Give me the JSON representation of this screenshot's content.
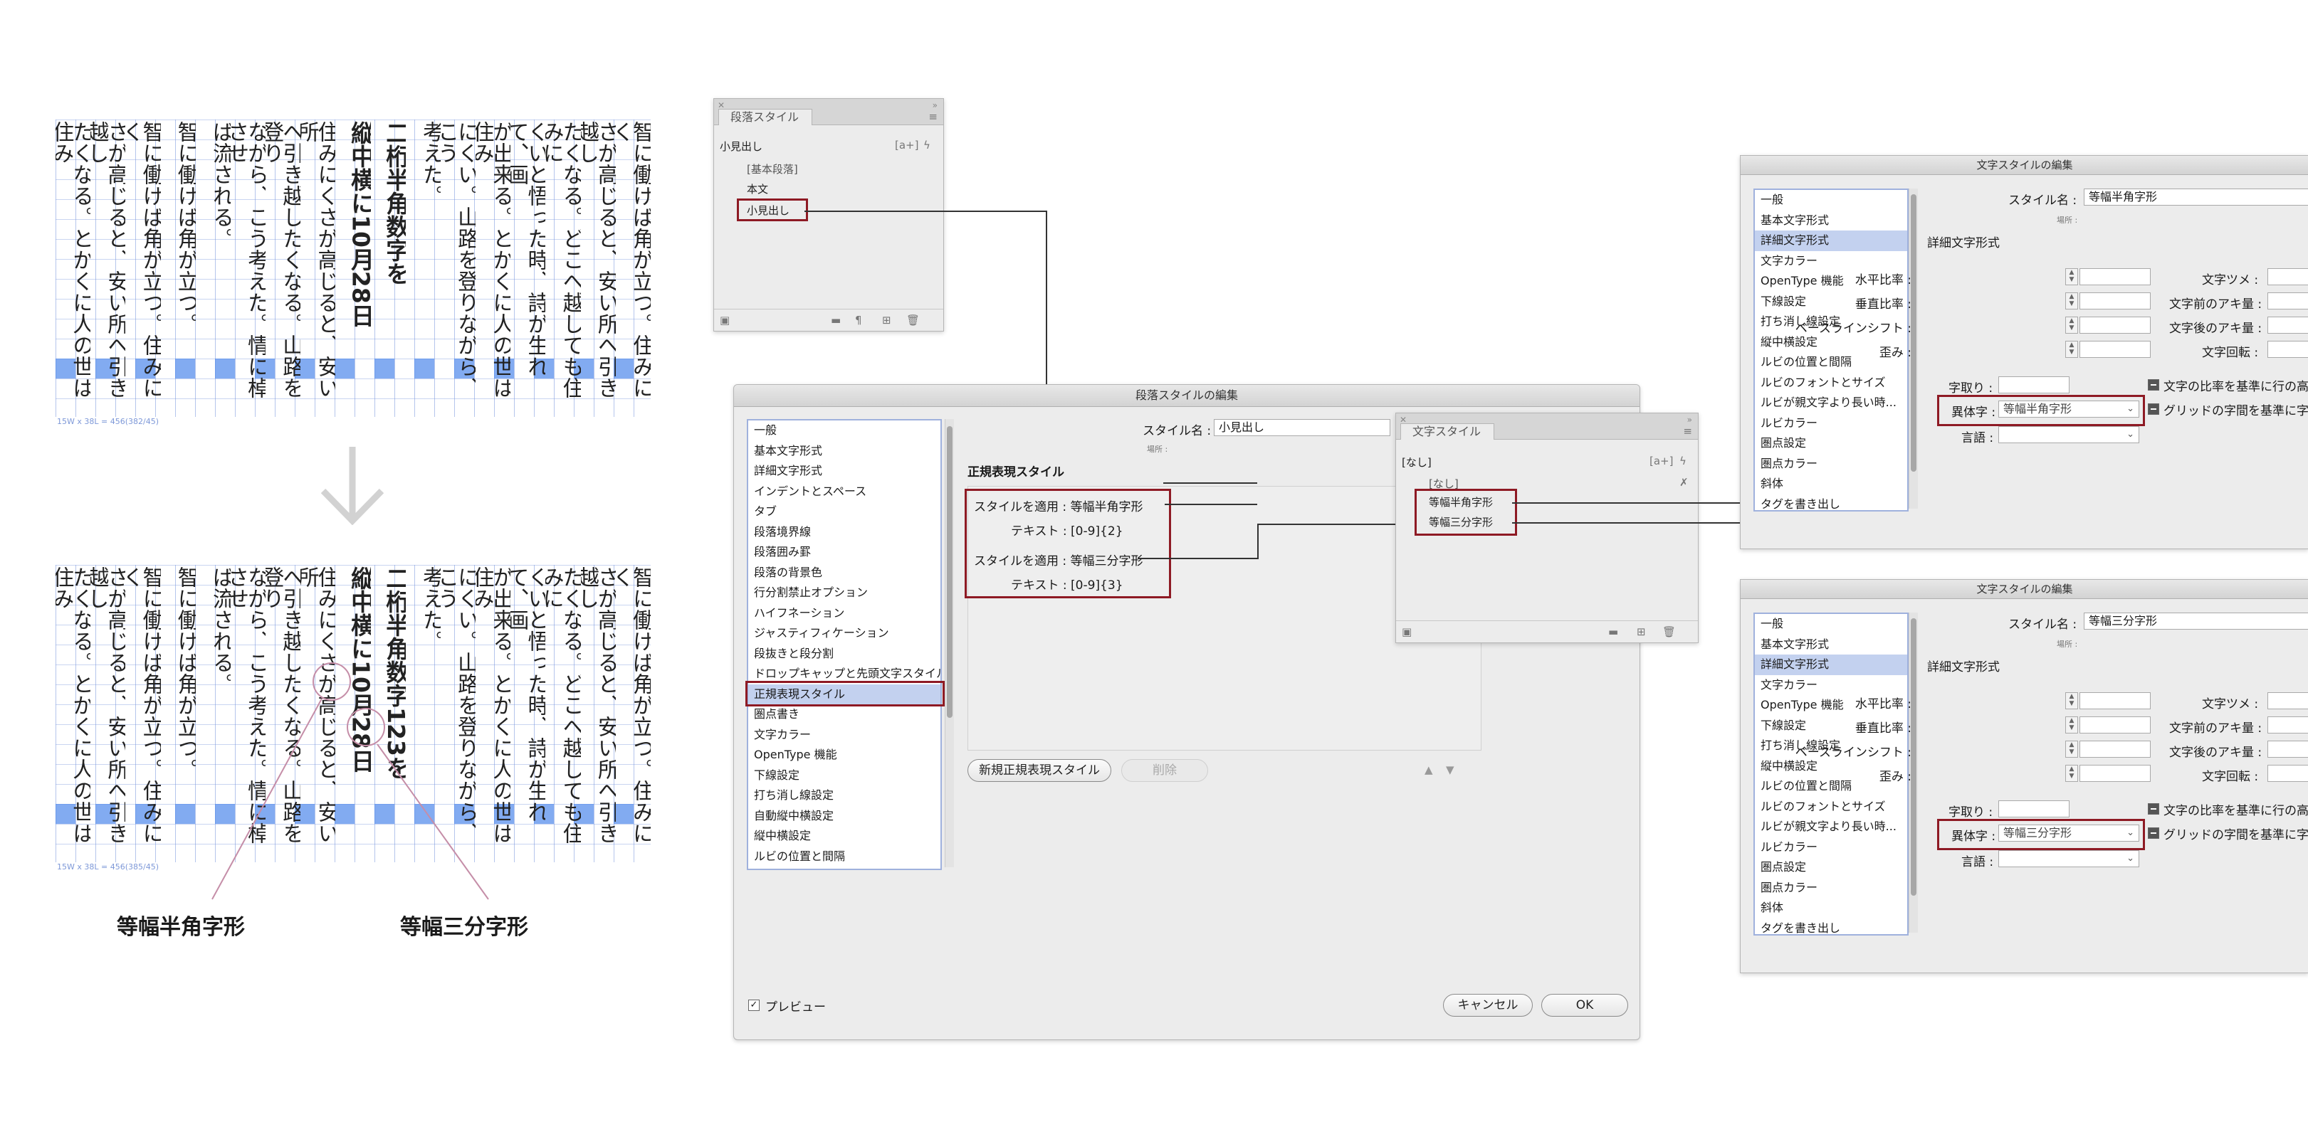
{
  "sample": {
    "before": {
      "columns": [
        "智に働けば角が立つ。住みにく",
        "さが高じると、安い所へ引き越し",
        "たくなる。どこへ越しても住みに",
        "くいと悟った時、詩が生れて、画",
        "が出来る。とかくに人の世は住み",
        "にくい。山路を登りながら、こう",
        "考えた。",
        "二桁半角数字を",
        "縦中横に10月28日",
        "住みにくさが高じると、安い所",
        "へ引き越したくなる。山路を登り",
        "ながら、こう考えた。情に棹させ",
        "ば流される。",
        "智に働けば角が立つ。",
        "智に働けば角が立つ。住みにく",
        "さが高じると、安い所へ引き越し",
        "たくなる。とかくに人の世は住み"
      ],
      "caption": "15W x 38L = 456(382/45)"
    },
    "after": {
      "columns": [
        "智に働けば角が立つ。住みにく",
        "さが高じると、安い所へ引き越し",
        "たくなる。どこへ越しても住みに",
        "くいと悟った時、詩が生れて、画",
        "が出来る。とかくに人の世は住み",
        "にくい。山路を登りながら、こう",
        "考えた。",
        "二桁半角数字123を",
        "縦中横に10月28日",
        "住みにくさが高じると、安い所",
        "へ引き越したくなる。山路を登り",
        "ながら、こう考えた。情に棹させ",
        "ば流される。",
        "智に働けば角が立つ。",
        "智に働けば角が立つ。住みにく",
        "さが高じると、安い所へ引き越し",
        "たくなる。とかくに人の世は住み"
      ],
      "caption": "15W x 38L = 456(385/45)"
    },
    "label_half": "等幅半角字形",
    "label_third": "等幅三分字形"
  },
  "para_panel": {
    "tab": "段落スタイル",
    "current": "小見出し",
    "items": [
      "[基本段落]",
      "本文",
      "小見出し"
    ]
  },
  "para_dialog": {
    "title": "段落スタイルの編集",
    "categories": [
      "一般",
      "基本文字形式",
      "詳細文字形式",
      "インデントとスペース",
      "タブ",
      "段落境界線",
      "段落囲み罫",
      "段落の背景色",
      "行分割禁止オプション",
      "ハイフネーション",
      "ジャスティフィケーション",
      "段抜きと段分割",
      "ドロップキャップと先頭文字スタイル",
      "正規表現スタイル",
      "圏点書き",
      "文字カラー",
      "OpenType 機能",
      "下線設定",
      "打ち消し線設定",
      "自動縦中横設定",
      "縦中横設定",
      "ルビの位置と間隔"
    ],
    "style_name_label": "スタイル名 :",
    "style_name": "小見出し",
    "location_label": "場所 :",
    "section": "正規表現スタイル",
    "rules": [
      {
        "apply": "スタイルを適用 : 等幅半角字形",
        "text": "テキスト : [0-9]{2}"
      },
      {
        "apply": "スタイルを適用 : 等幅三分字形",
        "text": "テキスト : [0-9]{3}"
      }
    ],
    "new_button": "新規正規表現スタイル",
    "delete_button": "削除",
    "preview": "プレビュー",
    "cancel": "キャンセル",
    "ok": "OK"
  },
  "char_panel": {
    "tab": "文字スタイル",
    "current": "[なし]",
    "items": [
      "[なし]",
      "等幅半角字形",
      "等幅三分字形"
    ]
  },
  "char_dialogs": [
    {
      "title": "文字スタイルの編集",
      "categories": [
        "一般",
        "基本文字形式",
        "詳細文字形式",
        "文字カラー",
        "OpenType 機能",
        "下線設定",
        "打ち消し線設定",
        "縦中横設定",
        "ルビの位置と間隔",
        "ルビのフォントとサイズ",
        "ルビが親文字より長い時...",
        "ルビカラー",
        "圏点設定",
        "圏点カラー",
        "斜体",
        "タグを書き出し"
      ],
      "style_name_label": "スタイル名 :",
      "style_name": "等幅半角字形",
      "location_label": "場所 :",
      "section": "詳細文字形式",
      "left_labels": [
        "水平比率 :",
        "垂直比率 :",
        "ベースラインシフト :",
        "歪み :"
      ],
      "right_labels": [
        "文字ツメ :",
        "文字前のアキ量 :",
        "文字後のアキ量 :",
        "文字回転 :"
      ],
      "tsumori": "字取り :",
      "ratio_check": "文字の比率を基準に行の高",
      "igji_label": "異体字 :",
      "igji_value": "等幅半角字形",
      "grid_check": "グリッドの字間を基準に字",
      "lang_label": "言語 :"
    },
    {
      "title": "文字スタイルの編集",
      "categories": [
        "一般",
        "基本文字形式",
        "詳細文字形式",
        "文字カラー",
        "OpenType 機能",
        "下線設定",
        "打ち消し線設定",
        "縦中横設定",
        "ルビの位置と間隔",
        "ルビのフォントとサイズ",
        "ルビが親文字より長い時...",
        "ルビカラー",
        "圏点設定",
        "圏点カラー",
        "斜体",
        "タグを書き出し"
      ],
      "style_name_label": "スタイル名 :",
      "style_name": "等幅三分字形",
      "location_label": "場所 :",
      "section": "詳細文字形式",
      "left_labels": [
        "水平比率 :",
        "垂直比率 :",
        "ベースラインシフト :",
        "歪み :"
      ],
      "right_labels": [
        "文字ツメ :",
        "文字前のアキ量 :",
        "文字後のアキ量 :",
        "文字回転 :"
      ],
      "tsumori": "字取り :",
      "ratio_check": "文字の比率を基準に行の高",
      "igji_label": "異体字 :",
      "igji_value": "等幅三分字形",
      "grid_check": "グリッドの字間を基準に字",
      "lang_label": "言語 :"
    }
  ],
  "colors": {
    "highlight": "#8e1a24",
    "selection": "#c3d1ef",
    "grid": "#7896dc"
  }
}
